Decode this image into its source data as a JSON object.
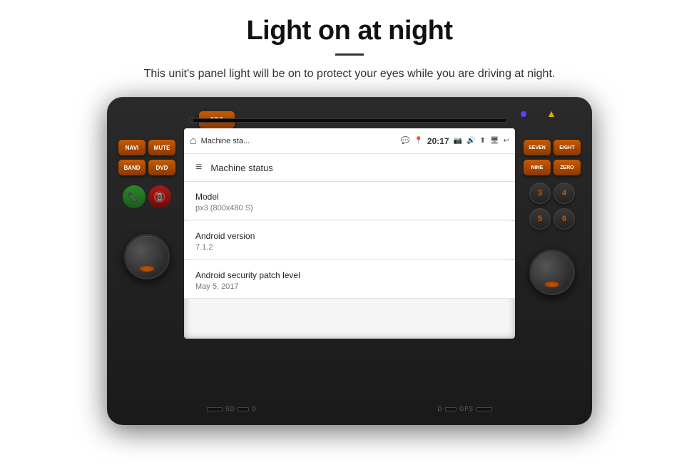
{
  "header": {
    "title": "Light on at night",
    "subtitle": "This unit's panel light will be on to protect your eyes while you are driving at night.",
    "divider": true
  },
  "device": {
    "cd_slot": true,
    "left_buttons": {
      "btn1": "SRC",
      "btn2": "NAVI",
      "btn3": "MUTE",
      "btn4": "BAND",
      "btn5": "DVD"
    },
    "right_buttons": {
      "btn1": "SEVEN",
      "btn2": "EIGHT",
      "btn3": "NINE",
      "btn4": "ZERO"
    },
    "number_pad": [
      "7",
      "8",
      "9",
      "0",
      "3",
      "4",
      "5",
      "6"
    ]
  },
  "android_screen": {
    "status_bar": {
      "app_title": "Machine sta...",
      "time": "20:17",
      "icons": [
        "home",
        "chat",
        "location",
        "camera",
        "volume",
        "upload",
        "monitor",
        "back"
      ]
    },
    "toolbar": {
      "menu_icon": "≡",
      "title": "Machine status"
    },
    "list_items": [
      {
        "label": "Model",
        "value": "px3 (800x480 S)"
      },
      {
        "label": "Android version",
        "value": "7.1.2"
      },
      {
        "label": "Android security patch level",
        "value": "May 5, 2017"
      }
    ]
  },
  "bottom_labels": {
    "left": "SD",
    "left2": "D",
    "right": "D",
    "right2": "GPS"
  }
}
